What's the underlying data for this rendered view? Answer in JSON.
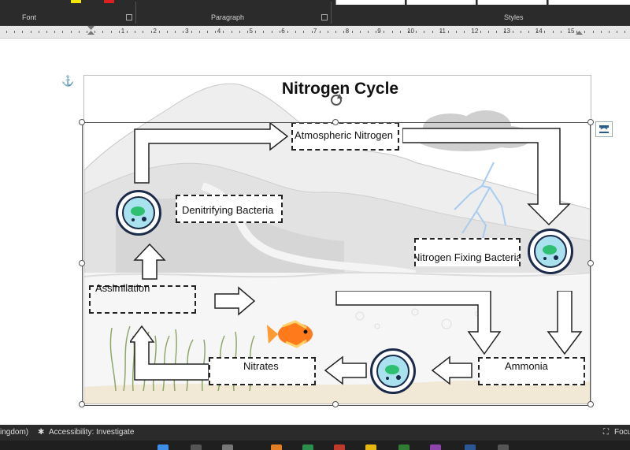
{
  "ribbon": {
    "groups": [
      "Font",
      "Paragraph",
      "Styles"
    ]
  },
  "ruler": {
    "numbers": [
      "1",
      "2",
      "3",
      "4",
      "5",
      "6",
      "7",
      "8",
      "9",
      "10",
      "11",
      "12",
      "13",
      "14",
      "15"
    ]
  },
  "diagram": {
    "title": "Nitrogen Cycle",
    "boxes": {
      "atmospheric": "Atmospheric Nitrogen",
      "denitrifying": "Denitrifying Bacteria",
      "nitrogen_fixing": "Nitrogen Fixing Bacteria",
      "assimilation": "Assimilation",
      "nitrates": "Nitrates",
      "ammonia": "Ammonia"
    }
  },
  "statusbar": {
    "language": "ingdom)",
    "accessibility": "Accessibility: Investigate",
    "focus": "Focus"
  },
  "colors": {
    "ribbon_bg": "#2b2b2b",
    "bacteria_fill": "#a9e2ee",
    "bacteria_outline": "#1b2a49",
    "bacteria_green": "#2fbf71"
  }
}
